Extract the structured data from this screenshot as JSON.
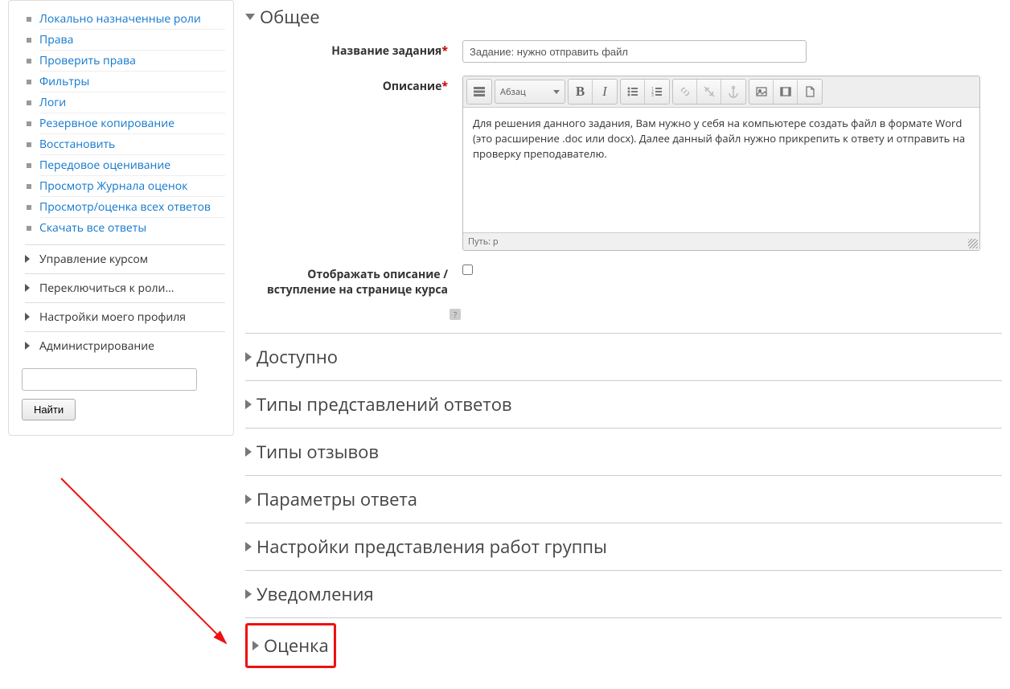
{
  "sidebar": {
    "nav_items": [
      "Локально назначенные роли",
      "Права",
      "Проверить права",
      "Фильтры",
      "Логи",
      "Резервное копирование",
      "Восстановить",
      "Передовое оценивание",
      "Просмотр Журнала оценок",
      "Просмотр/оценка всех ответов",
      "Скачать все ответы"
    ],
    "tree_items": [
      "Управление курсом",
      "Переключиться к роли...",
      "Настройки моего профиля",
      "Администрирование"
    ],
    "search_value": "",
    "search_button": "Найти"
  },
  "sections": {
    "general": {
      "title": "Общее",
      "name_label": "Название задания",
      "name_value": "Задание: нужно отправить файл",
      "desc_label": "Описание",
      "editor": {
        "format_label": "Абзац",
        "content": "Для решения данного задания, Вам нужно у себя на компьютере создать файл в формате Word (это расширение .doc или docx). Далее данный файл нужно прикрепить к ответу и отправить на проверку преподавателю.",
        "path_label": "Путь: p"
      },
      "showdesc_label": "Отображать описание / вступление на странице курса",
      "help": "?"
    },
    "collapsed": [
      "Доступно",
      "Типы представлений ответов",
      "Типы отзывов",
      "Параметры ответа",
      "Настройки представления работ группы",
      "Уведомления",
      "Оценка"
    ]
  }
}
